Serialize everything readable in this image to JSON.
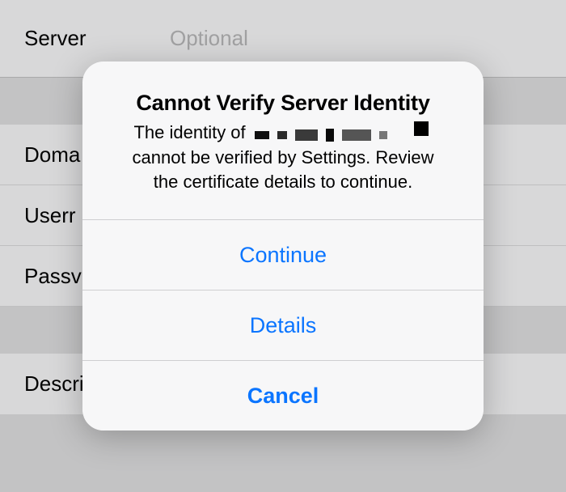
{
  "background": {
    "row_server": {
      "label": "Server",
      "placeholder": "Optional"
    },
    "row_domain_label": "Doma",
    "row_username_label": "Userr",
    "row_password_label": "Passv",
    "row_description_label": "Descrip"
  },
  "alert": {
    "title": "Cannot Verify Server Identity",
    "message_line1_prefix": "The identity of ",
    "message_line2": "cannot be verified by Settings. Review",
    "message_line3": "the certificate details to continue.",
    "buttons": {
      "continue": "Continue",
      "details": "Details",
      "cancel": "Cancel"
    }
  }
}
